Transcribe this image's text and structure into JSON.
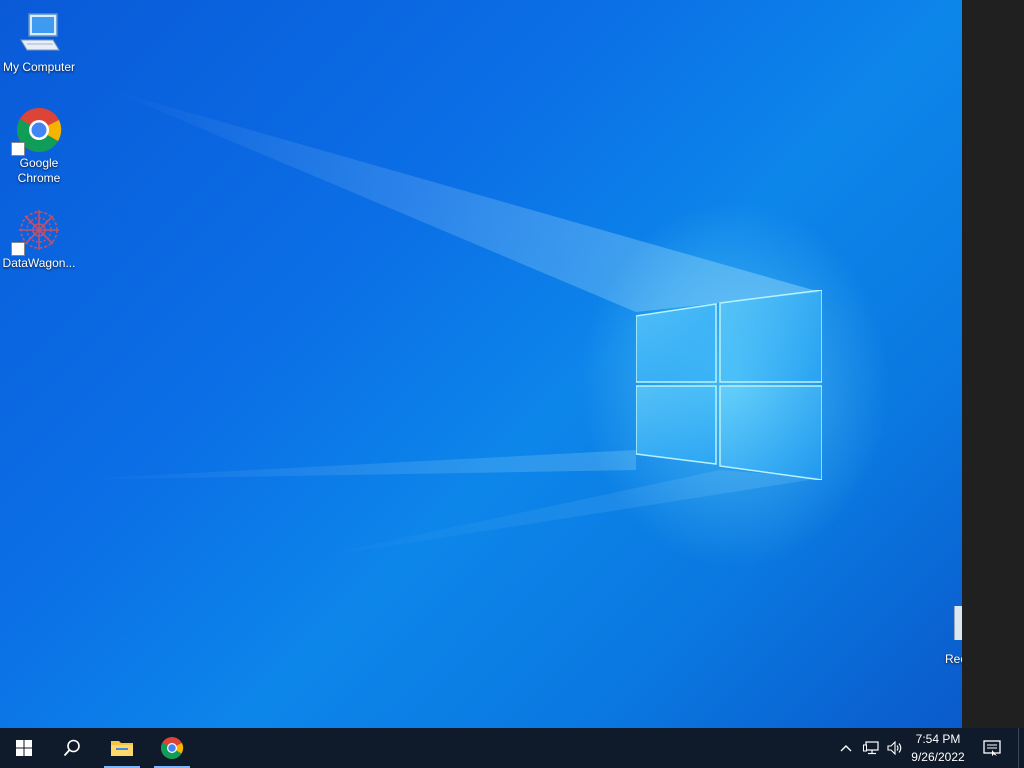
{
  "desktop": {
    "icons": [
      {
        "label": "My Computer"
      },
      {
        "label": "Google Chrome"
      },
      {
        "label": "DataWagon..."
      }
    ],
    "recycle_bin_partial_label": "Rec"
  },
  "taskbar": {
    "clock_time": "7:54 PM",
    "clock_date": "9/26/2022",
    "pinned": [
      "start-icon",
      "search-icon",
      "file-explorer-icon",
      "chrome-icon"
    ]
  },
  "colors": {
    "taskbar_bg": "#0f1a2b",
    "side_panel_bg": "#202020",
    "wallpaper_primary": "#0b6fe6"
  }
}
